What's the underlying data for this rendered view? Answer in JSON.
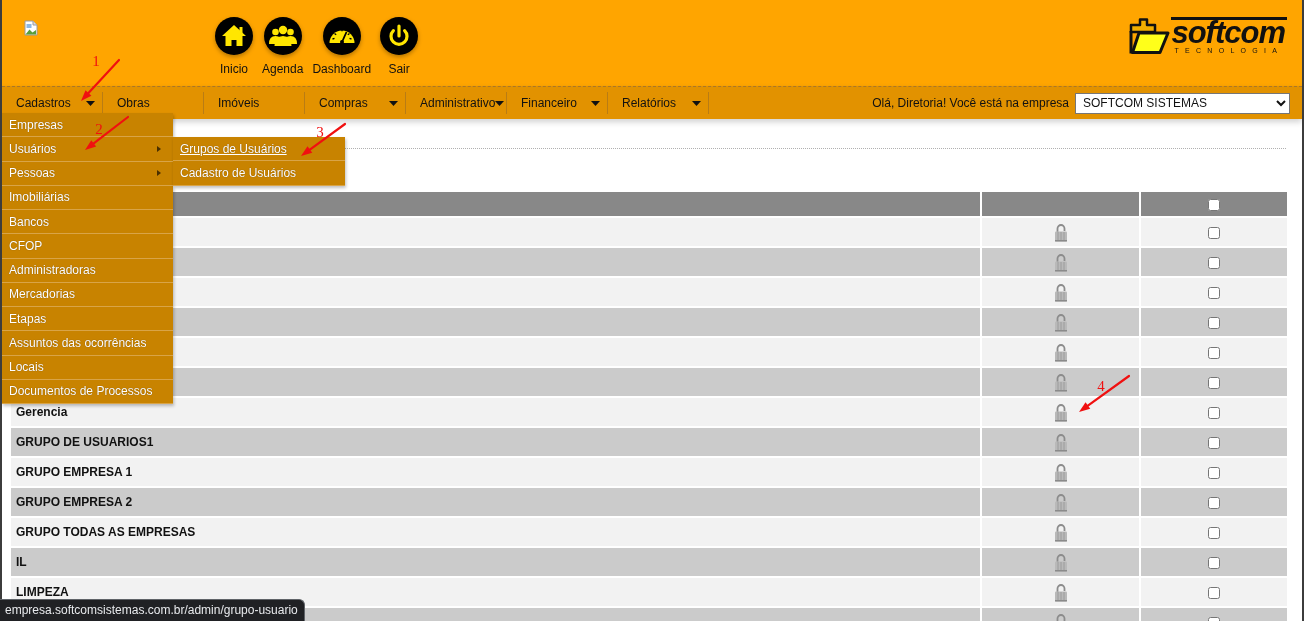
{
  "header": {
    "shortcuts": [
      {
        "kind": "home",
        "label": "Inicio"
      },
      {
        "kind": "people",
        "label": "Agenda"
      },
      {
        "kind": "gauge",
        "label": "Dashboard"
      },
      {
        "kind": "power",
        "label": "Sair"
      }
    ],
    "logo": {
      "name": "softcom",
      "tagline": "TECNOLOGIA"
    }
  },
  "menu_bar": {
    "items": [
      {
        "label": "Cadastros",
        "has_submenu": true,
        "children": [
          {
            "label": "Empresas",
            "has_submenu": false
          },
          {
            "label": "Usuários",
            "has_submenu": true,
            "children": [
              {
                "label": "Grupos de Usuários",
                "hovered": true
              },
              {
                "label": "Cadastro de Usuários",
                "hovered": false
              }
            ]
          },
          {
            "label": "Pessoas",
            "has_submenu": true
          },
          {
            "label": "Imobiliárias",
            "has_submenu": false
          },
          {
            "label": "Bancos",
            "has_submenu": false
          },
          {
            "label": "CFOP",
            "has_submenu": false
          },
          {
            "label": "Administradoras",
            "has_submenu": false
          },
          {
            "label": "Mercadorias",
            "has_submenu": false
          },
          {
            "label": "Etapas",
            "has_submenu": false
          },
          {
            "label": "Assuntos das ocorrências",
            "has_submenu": false
          },
          {
            "label": "Locais",
            "has_submenu": false
          },
          {
            "label": "Documentos de Processos",
            "has_submenu": false
          }
        ]
      },
      {
        "label": "Obras",
        "has_submenu": false
      },
      {
        "label": "Imóveis",
        "has_submenu": false
      },
      {
        "label": "Compras",
        "has_submenu": true
      },
      {
        "label": "Administrativo",
        "has_submenu": true
      },
      {
        "label": "Financeiro",
        "has_submenu": true
      },
      {
        "label": "Relatórios",
        "has_submenu": true
      }
    ],
    "greeting": "Olá, Diretoria! Você está na empresa",
    "company_select": {
      "value": "SOFTCOM SISTEMAS"
    }
  },
  "table": {
    "select_all": {
      "checked": false
    },
    "rows": [
      {
        "checked": false
      },
      {
        "checked": false
      },
      {
        "checked": false
      },
      {
        "checked": false
      },
      {
        "checked": false
      },
      {
        "checked": false
      },
      {
        "name": "Gerencia",
        "checked": false
      },
      {
        "name": "GRUPO DE USUARIOS1",
        "checked": false
      },
      {
        "name": "GRUPO EMPRESA 1",
        "checked": false
      },
      {
        "name": "GRUPO EMPRESA 2",
        "checked": false
      },
      {
        "name": "GRUPO TODAS AS EMPRESAS",
        "checked": false
      },
      {
        "name": "IL",
        "checked": false
      },
      {
        "name": "LIMPEZA",
        "checked": false
      },
      {
        "checked": false
      }
    ]
  },
  "annotations": [
    {
      "label": "1"
    },
    {
      "label": "2"
    },
    {
      "label": "3"
    },
    {
      "label": "4"
    }
  ],
  "status_bar": {
    "url": "empresa.softcomsistemas.com.br/admin/grupo-usuario"
  }
}
